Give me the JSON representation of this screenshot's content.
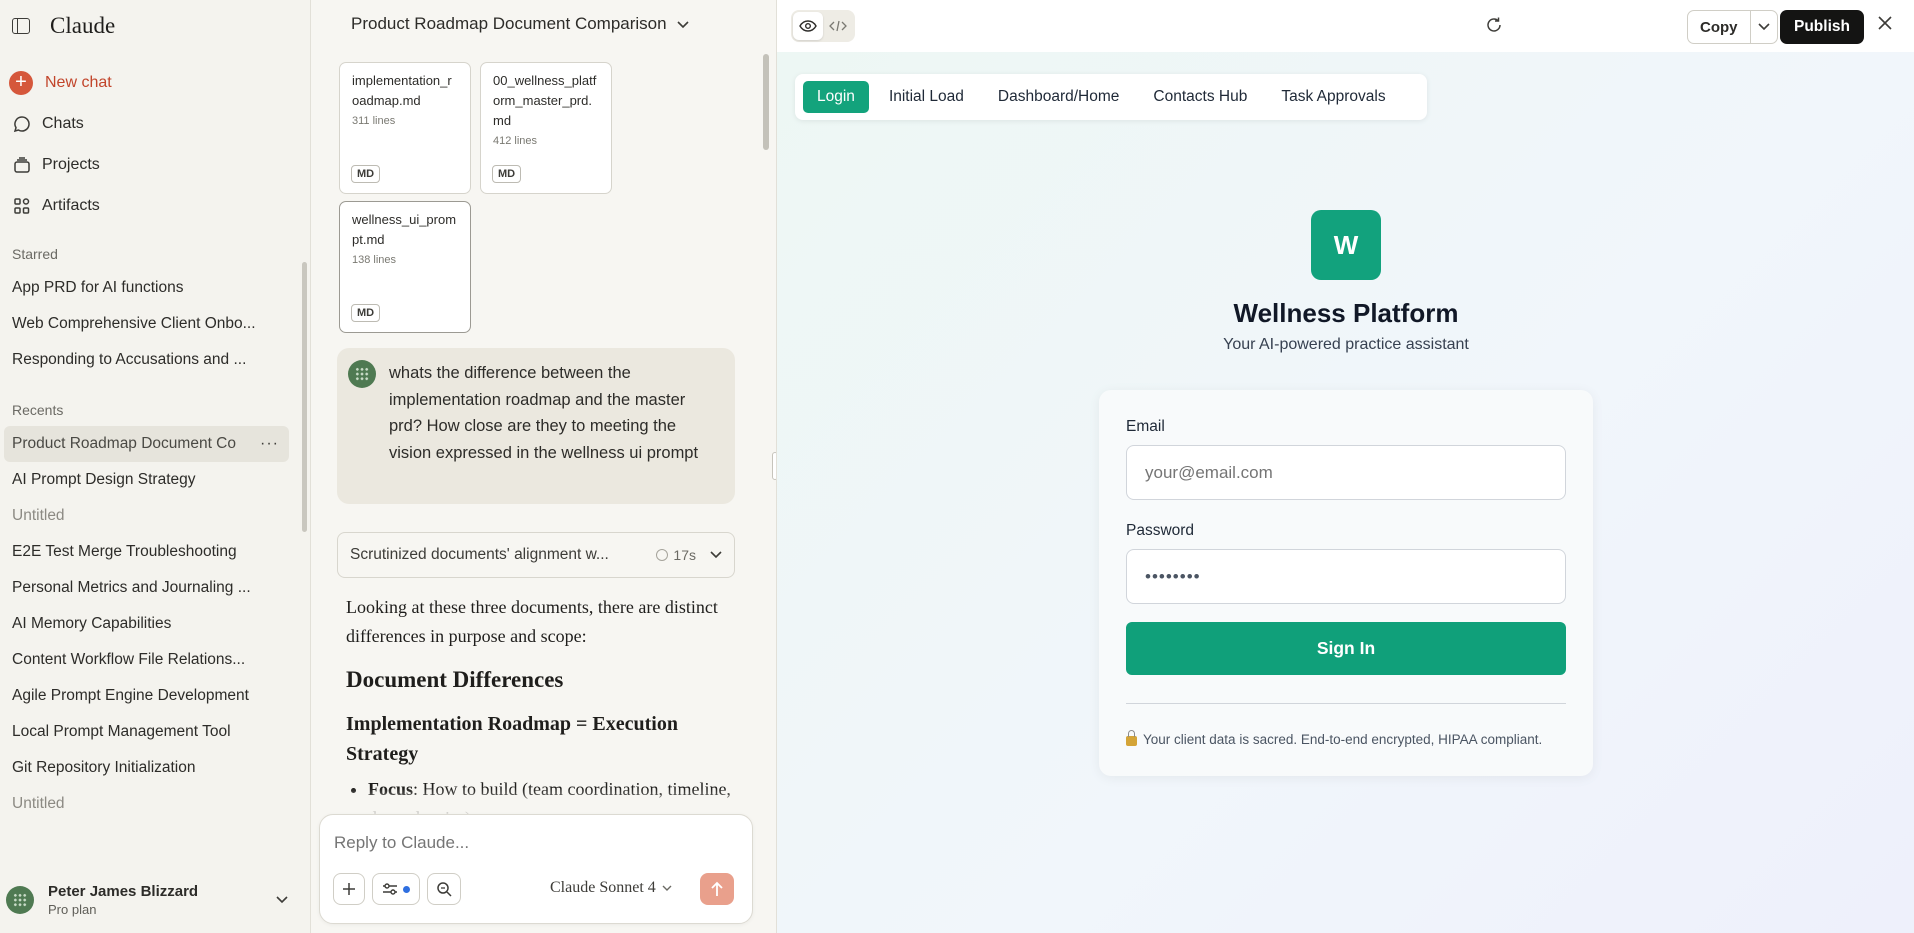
{
  "sidebar": {
    "brand": "Claude",
    "new_chat": "New chat",
    "nav": [
      "Chats",
      "Projects",
      "Artifacts"
    ],
    "starred_heading": "Starred",
    "starred": [
      "App PRD for AI functions",
      "Web Comprehensive Client Onbo...",
      "Responding to Accusations and ..."
    ],
    "recents_heading": "Recents",
    "recents": [
      "Product Roadmap Document Co",
      "AI Prompt Design Strategy",
      "Untitled",
      "E2E Test Merge Troubleshooting",
      "Personal Metrics and Journaling ...",
      "AI Memory Capabilities",
      "Content Workflow File Relations...",
      "Agile Prompt Engine Development",
      "Local Prompt Management Tool",
      "Git Repository Initialization",
      "Untitled"
    ],
    "active_more": "···",
    "user": {
      "name": "Peter James Blizzard",
      "plan": "Pro plan"
    }
  },
  "chat": {
    "title": "Product Roadmap Document Comparison",
    "files": [
      {
        "name": "implementation_roadmap.md",
        "lines": "311 lines",
        "badge": "MD"
      },
      {
        "name": "00_wellness_platform_master_prd.md",
        "lines": "412 lines",
        "badge": "MD"
      },
      {
        "name": "wellness_ui_prompt.md",
        "lines": "138 lines",
        "badge": "MD"
      }
    ],
    "user_message": "whats the difference between the implementation roadmap and the master prd? How close are they to meeting the vision expressed in the wellness ui prompt",
    "thinking": {
      "label": "Scrutinized documents' alignment w...",
      "time": "17s"
    },
    "response": {
      "intro": "Looking at these three documents, there are distinct differences in purpose and scope:",
      "h2": "Document Differences",
      "h3": "Implementation Roadmap = Execution Strategy",
      "bullet_bold": "Focus",
      "bullet_text": ": How to build (team coordination, timeline, dependencies)"
    },
    "composer": {
      "placeholder": "Reply to Claude...",
      "model": "Claude Sonnet 4"
    }
  },
  "artifact": {
    "copy_label": "Copy",
    "publish_label": "Publish",
    "tabs": [
      "Login",
      "Initial Load",
      "Dashboard/Home",
      "Contacts Hub",
      "Task Approvals"
    ],
    "app": {
      "logo_letter": "W",
      "title": "Wellness Platform",
      "subtitle": "Your AI-powered practice assistant",
      "email_label": "Email",
      "email_placeholder": "your@email.com",
      "password_label": "Password",
      "password_value": "••••••••",
      "signin_label": "Sign In",
      "security_note": "Your client data is sacred. End-to-end encrypted, HIPAA compliant."
    }
  },
  "colors": {
    "brand_orange": "#d5573b",
    "accent_green": "#10a07a",
    "publish_dark": "#141413"
  }
}
